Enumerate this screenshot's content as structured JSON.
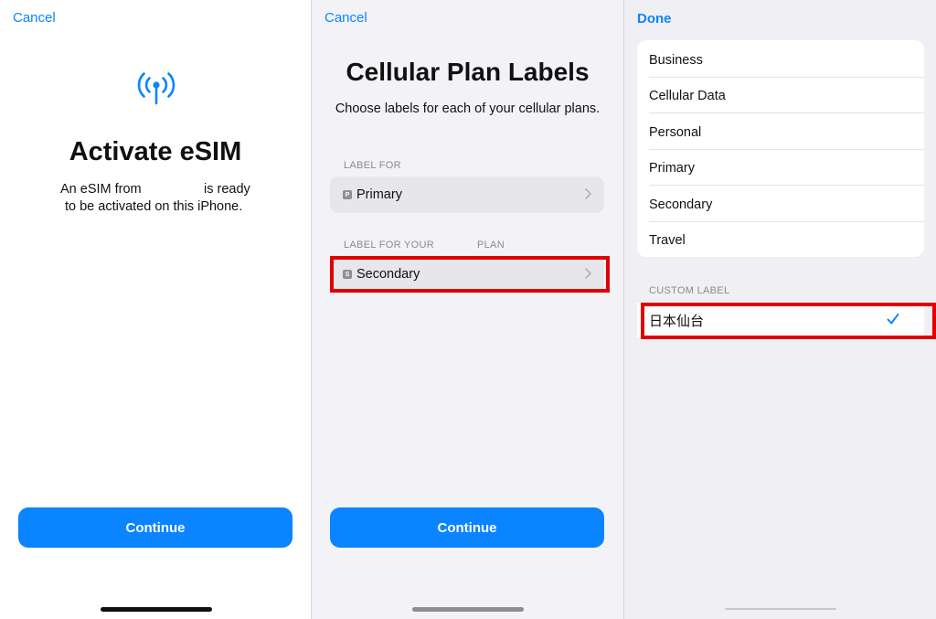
{
  "screen1": {
    "cancel_label": "Cancel",
    "icon": "antenna-radiowaves-icon",
    "title": "Activate eSIM",
    "desc_line1_a": "An eSIM from",
    "desc_line1_b": "is ready",
    "desc_line2": "to be activated on this iPhone.",
    "continue_label": "Continue"
  },
  "screen2": {
    "cancel_label": "Cancel",
    "title": "Cellular Plan Labels",
    "subtitle": "Choose labels for each of your cellular plans.",
    "section1_header": "LABEL FOR",
    "row1": {
      "badge": "P",
      "label": "Primary"
    },
    "section2_header_a": "LABEL FOR YOUR",
    "section2_header_b": "PLAN",
    "row2": {
      "badge": "S",
      "label": "Secondary"
    },
    "continue_label": "Continue"
  },
  "screen3": {
    "done_label": "Done",
    "options": [
      "Business",
      "Cellular Data",
      "Personal",
      "Primary",
      "Secondary",
      "Travel"
    ],
    "custom_header": "CUSTOM LABEL",
    "custom_value": "日本仙台",
    "custom_selected": true
  },
  "colors": {
    "accent": "#0a84ff",
    "highlight": "#e00000"
  }
}
